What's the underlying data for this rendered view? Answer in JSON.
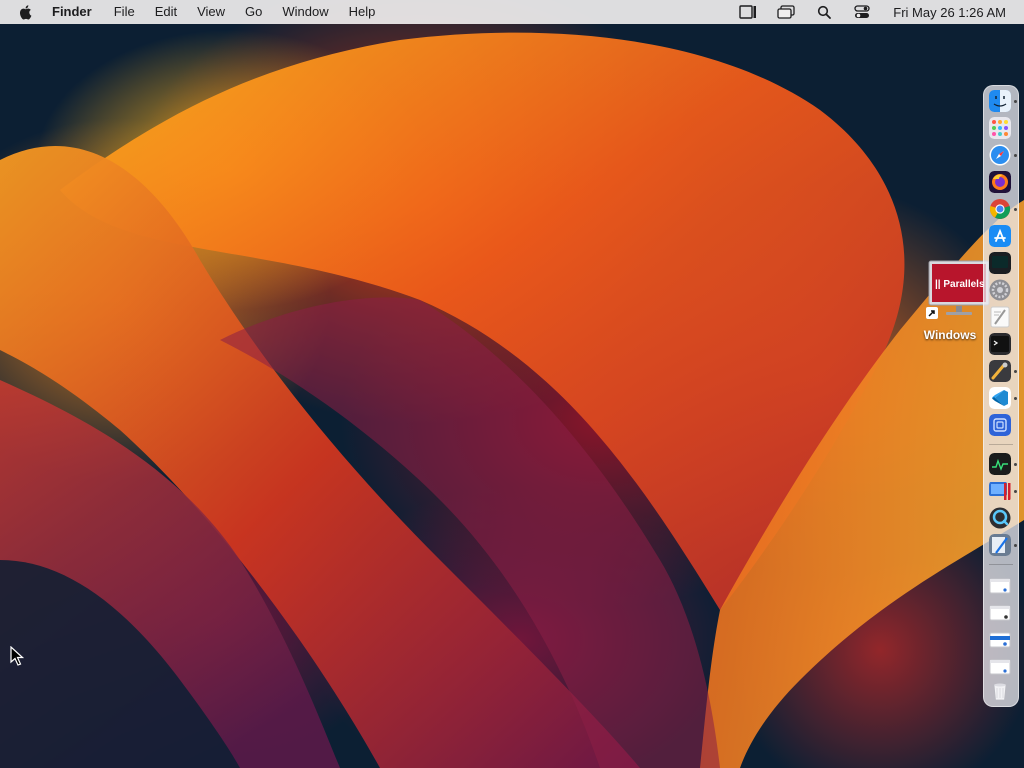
{
  "menubar": {
    "apple_icon": "apple-logo-icon",
    "app_name": "Finder",
    "menus": [
      "File",
      "Edit",
      "View",
      "Go",
      "Window",
      "Help"
    ],
    "status_icons": [
      "stage-manager-icon",
      "screen-mirroring-icon",
      "spotlight-search-icon",
      "control-center-icon"
    ],
    "clock": "Fri May 26  1:26 AM"
  },
  "desktop": {
    "shortcut": {
      "label": "Windows",
      "thumbnail_text": "|| Parallels",
      "icon": "parallels-windows-vm-icon",
      "alias_arrow": "alias-arrow-icon"
    }
  },
  "dock": {
    "apps": [
      {
        "name": "finder",
        "icon": "finder-icon",
        "running": true
      },
      {
        "name": "launchpad",
        "icon": "launchpad-icon",
        "running": false
      },
      {
        "name": "safari",
        "icon": "safari-icon",
        "running": true
      },
      {
        "name": "firefox",
        "icon": "firefox-icon",
        "running": false
      },
      {
        "name": "chrome",
        "icon": "chrome-icon",
        "running": true
      },
      {
        "name": "app-store",
        "icon": "app-store-icon",
        "running": false
      },
      {
        "name": "terminal-dark",
        "icon": "terminal-icon",
        "running": false
      },
      {
        "name": "system-settings",
        "icon": "gear-icon",
        "running": false
      },
      {
        "name": "textedit",
        "icon": "textedit-icon",
        "running": false
      },
      {
        "name": "terminal",
        "icon": "terminal-prompt-icon",
        "running": false
      },
      {
        "name": "instruments",
        "icon": "instruments-icon",
        "running": true
      },
      {
        "name": "vscode",
        "icon": "vscode-icon",
        "running": true
      },
      {
        "name": "simulator",
        "icon": "simulator-icon",
        "running": false
      }
    ],
    "recent": [
      {
        "name": "activity-monitor",
        "icon": "activity-monitor-icon",
        "running": true
      },
      {
        "name": "parallels-desktop",
        "icon": "parallels-icon",
        "running": true
      },
      {
        "name": "quicktime",
        "icon": "quicktime-icon",
        "running": false
      },
      {
        "name": "xcode-editor",
        "icon": "pen-editor-icon",
        "running": true
      }
    ],
    "stacks": [
      {
        "name": "downloads-stack-1",
        "icon": "window-thumbnail-icon"
      },
      {
        "name": "downloads-stack-2",
        "icon": "window-thumbnail-icon"
      },
      {
        "name": "downloads-stack-3",
        "icon": "window-thumbnail-icon"
      },
      {
        "name": "downloads-stack-4",
        "icon": "window-thumbnail-icon"
      },
      {
        "name": "trash",
        "icon": "trash-icon"
      }
    ]
  },
  "colors": {
    "menubar_bg": "#f0eeee",
    "wallpaper_orange": "#f28a1e",
    "wallpaper_red": "#d9361c",
    "wallpaper_purple": "#7a1a45",
    "wallpaper_navy": "#0c1f33"
  }
}
